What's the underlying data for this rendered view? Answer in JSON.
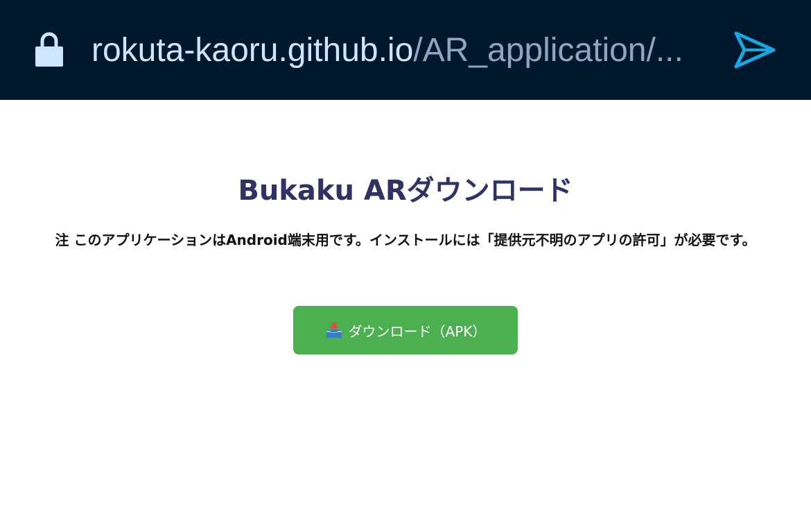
{
  "browser": {
    "url_host": "rokuta-kaoru.github.io",
    "url_path": "/AR_application/...",
    "lock_icon": "lock-icon",
    "send_icon": "send-icon"
  },
  "page": {
    "title": "Bukaku ARダウンロード",
    "notice": "注 このアプリケーションはAndroid端末用です。インストールには「提供元不明のアプリの許可」が必要です。",
    "download_button_label": "ダウンロード（APK）",
    "download_button_icon": "outbox-tray-icon"
  },
  "colors": {
    "topbar_bg": "#00182c",
    "title": "#2f3263",
    "button_bg": "#4caf50",
    "send_icon": "#1aa7e0"
  }
}
